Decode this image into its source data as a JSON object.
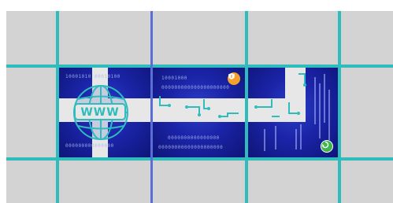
{
  "puzzle": {
    "tiles": [
      {
        "name": "www-globe",
        "label": "WWW",
        "top_text": "10001010 00010100",
        "bottom_text": "000000000000000"
      },
      {
        "name": "circuit-board",
        "top_code": "10001000",
        "top_dots": "000000000000000000000",
        "bottom_text_1": "0000000000000000",
        "bottom_text_2": "00000000000000000000",
        "badge_icon": "shield-badge-icon",
        "badge_color": "#f3a12a"
      },
      {
        "name": "maze-binary",
        "badge_icon": "recycle-icon",
        "badge_color": "#3db64a"
      }
    ],
    "colors": {
      "grid": "#2ebcbc",
      "cell": "#d3d3d3",
      "seam": "#5a6fd6",
      "tile_dark": "#0e1578",
      "tile_mid": "#2b3fc8"
    }
  }
}
